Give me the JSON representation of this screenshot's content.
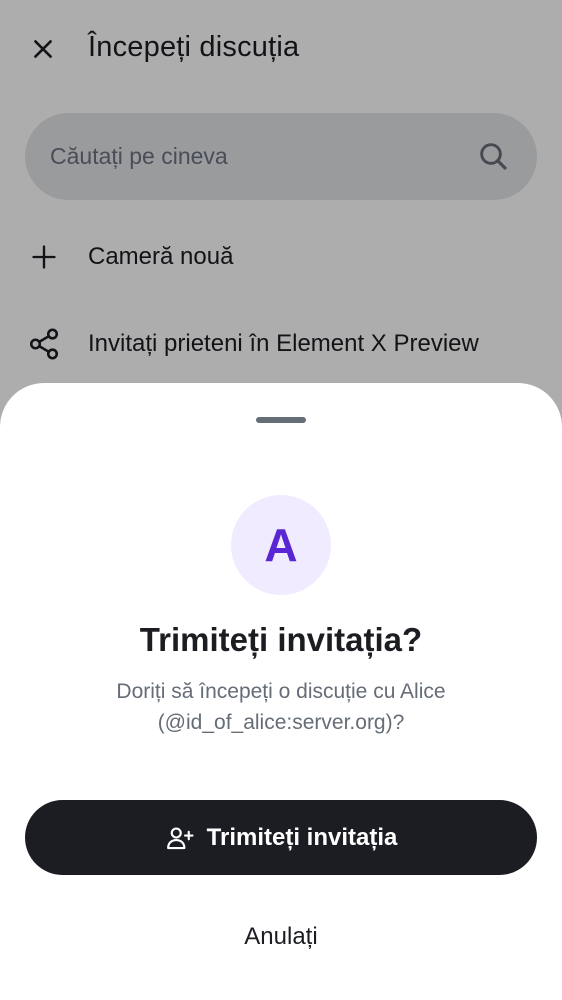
{
  "header": {
    "title": "Începeți discuția",
    "close_icon": "close-icon"
  },
  "search": {
    "placeholder": "Căutați pe cineva",
    "value": "",
    "icon": "search-icon"
  },
  "actions": [
    {
      "icon": "plus-icon",
      "label": "Cameră nouă"
    },
    {
      "icon": "share-icon",
      "label": "Invitați prieteni în Element X Preview"
    }
  ],
  "sheet": {
    "avatar_letter": "A",
    "title": "Trimiteți invitația?",
    "description": "Doriți să începeți o discuție cu Alice (@id_of_alice:server.org)?",
    "primary_button": {
      "icon": "add-user-icon",
      "label": "Trimiteți invitația"
    },
    "cancel_button": {
      "label": "Anulați"
    }
  },
  "colors": {
    "avatar_bg": "#f0ebff",
    "avatar_fg": "#5a26d3",
    "primary_button_bg": "#1b1d22",
    "text_primary": "#1b1d22",
    "text_secondary": "#656d77",
    "scrim": "rgba(0,0,0,0.32)"
  }
}
